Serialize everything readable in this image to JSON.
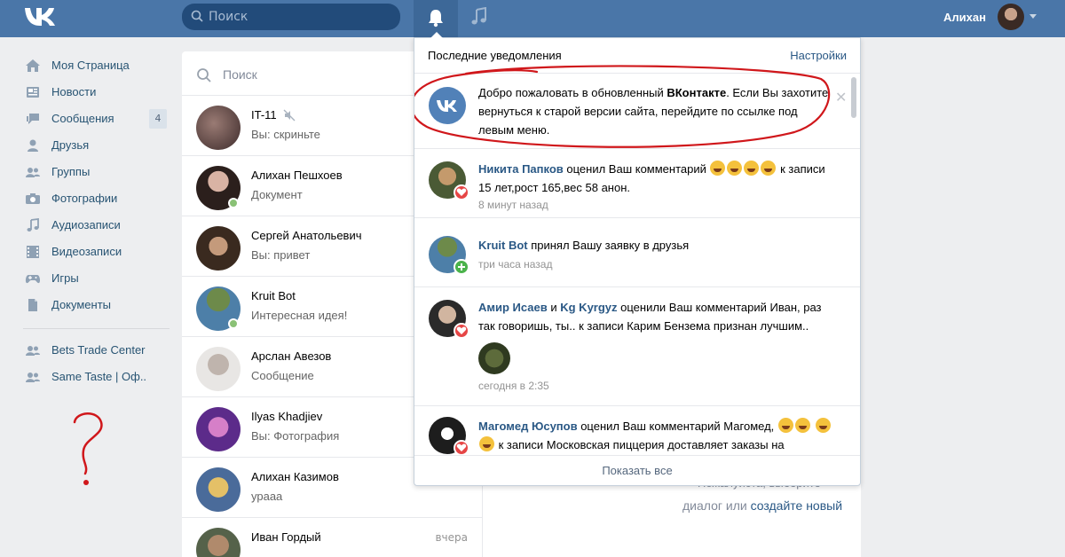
{
  "header": {
    "search_placeholder": "Поиск",
    "user_name": "Алихан"
  },
  "sidebar": {
    "items": [
      {
        "label": "Моя Страница",
        "icon": "home-icon"
      },
      {
        "label": "Новости",
        "icon": "news-icon"
      },
      {
        "label": "Сообщения",
        "icon": "messages-icon",
        "badge": "4"
      },
      {
        "label": "Друзья",
        "icon": "friends-icon"
      },
      {
        "label": "Группы",
        "icon": "groups-icon"
      },
      {
        "label": "Фотографии",
        "icon": "camera-icon"
      },
      {
        "label": "Аудиозаписи",
        "icon": "music-note-icon"
      },
      {
        "label": "Видеозаписи",
        "icon": "film-icon"
      },
      {
        "label": "Игры",
        "icon": "gamepad-icon"
      },
      {
        "label": "Документы",
        "icon": "document-icon"
      }
    ],
    "groups": [
      {
        "label": "Bets Trade Center",
        "icon": "group-icon"
      },
      {
        "label": "Same Taste | Оф..",
        "icon": "group-icon"
      }
    ],
    "annotation": "?"
  },
  "messages": {
    "search_placeholder": "Поиск",
    "dialogs": [
      {
        "name": "IT-11",
        "text": "Вы: скриньте",
        "muted": true,
        "online": false
      },
      {
        "name": "Алихан Пешхоев",
        "text": "Документ",
        "online": true
      },
      {
        "name": "Сергей Анатольевич",
        "text": "Вы: привет",
        "online": false
      },
      {
        "name": "Kruit Bot",
        "text": "Интересная идея!",
        "online": true
      },
      {
        "name": "Арслан Авезов",
        "text": "Сообщение",
        "online": false
      },
      {
        "name": "Ilyas Khadjiev",
        "text": "Вы: Фотография",
        "online": false
      },
      {
        "name": "Алихан Казимов",
        "text": "ураaa",
        "online": false
      },
      {
        "name": "Иван Гордый",
        "text": "",
        "time": "вчера",
        "online": false
      }
    ]
  },
  "right_pane": {
    "hint_line1": "Пожалуйста, выберите",
    "hint_line2_prefix": "диалог или ",
    "hint_line2_link": "создайте новый"
  },
  "notifications": {
    "title": "Последние уведомления",
    "settings_label": "Настройки",
    "welcome": {
      "part1": "Добро пожаловать в обновленный ",
      "bold": "ВКонтакте",
      "part2": ". Если Вы захотите вернуться к старой версии сайта, перейдите по ссылке под левым меню."
    },
    "items": [
      {
        "who": "Никита Папков",
        "action": " оценил Ваш комментарий ",
        "emoji_count": 4,
        "rest": " к записи 15 лет,рост 165,вес 58 анон.",
        "time": "8 минут назад",
        "reaction": "heart"
      },
      {
        "who": "Kruit Bot",
        "action": " принял Вашу заявку в друзья",
        "time": "три часа назад",
        "reaction": "plus"
      },
      {
        "who": "Амир Исаев",
        "and": " и ",
        "who2": "Kg Kyrgyz",
        "action": " оценили Ваш комментарий Иван, раз так говоришь, ты.. к записи Карим Бензема признан лучшим..",
        "time": "сегодня в 2:35",
        "reaction": "heart"
      },
      {
        "who": "Магомед Юсупов",
        "action": " оценил Ваш комментарий Магомед, ",
        "rest": " к записи Московская пиццерия доставляет заказы на",
        "reaction": "heart"
      }
    ],
    "show_all": "Показать все"
  },
  "colors": {
    "header": "#4a76a8",
    "link": "#2a5885",
    "annotation_red": "#d0171b"
  }
}
